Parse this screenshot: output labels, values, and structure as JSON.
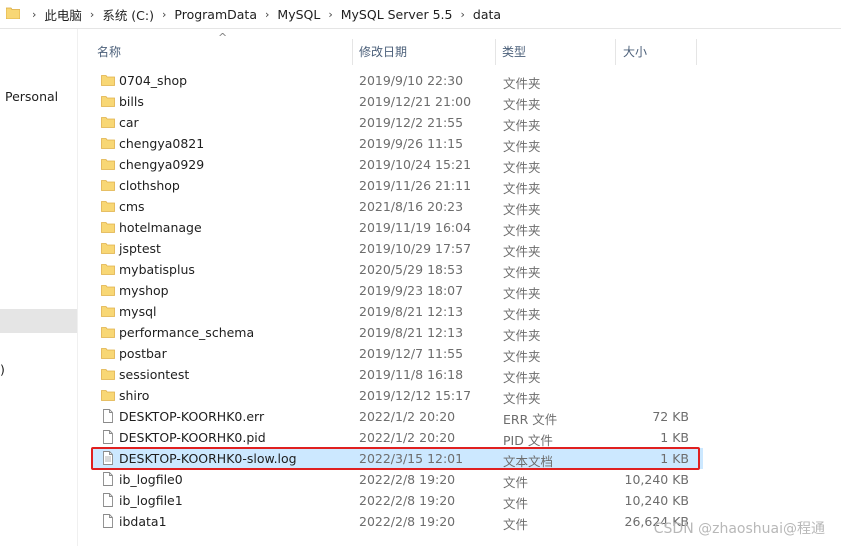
{
  "breadcrumb": [
    "此电脑",
    "系统 (C:)",
    "ProgramData",
    "MySQL",
    "MySQL Server 5.5",
    "data"
  ],
  "nav": {
    "personal": "Personal",
    "partial": ")"
  },
  "columns": {
    "name": "名称",
    "modified": "修改日期",
    "type": "类型",
    "size": "大小"
  },
  "sort_indicator": "^",
  "files": [
    {
      "name": "0704_shop",
      "modified": "2019/9/10 22:30",
      "type": "文件夹",
      "size": "",
      "kind": "folder"
    },
    {
      "name": "bills",
      "modified": "2019/12/21 21:00",
      "type": "文件夹",
      "size": "",
      "kind": "folder"
    },
    {
      "name": "car",
      "modified": "2019/12/2 21:55",
      "type": "文件夹",
      "size": "",
      "kind": "folder"
    },
    {
      "name": "chengya0821",
      "modified": "2019/9/26 11:15",
      "type": "文件夹",
      "size": "",
      "kind": "folder"
    },
    {
      "name": "chengya0929",
      "modified": "2019/10/24 15:21",
      "type": "文件夹",
      "size": "",
      "kind": "folder"
    },
    {
      "name": "clothshop",
      "modified": "2019/11/26 21:11",
      "type": "文件夹",
      "size": "",
      "kind": "folder"
    },
    {
      "name": "cms",
      "modified": "2021/8/16 20:23",
      "type": "文件夹",
      "size": "",
      "kind": "folder"
    },
    {
      "name": "hotelmanage",
      "modified": "2019/11/19 16:04",
      "type": "文件夹",
      "size": "",
      "kind": "folder"
    },
    {
      "name": "jsptest",
      "modified": "2019/10/29 17:57",
      "type": "文件夹",
      "size": "",
      "kind": "folder"
    },
    {
      "name": "mybatisplus",
      "modified": "2020/5/29 18:53",
      "type": "文件夹",
      "size": "",
      "kind": "folder"
    },
    {
      "name": "myshop",
      "modified": "2019/9/23 18:07",
      "type": "文件夹",
      "size": "",
      "kind": "folder"
    },
    {
      "name": "mysql",
      "modified": "2019/8/21 12:13",
      "type": "文件夹",
      "size": "",
      "kind": "folder"
    },
    {
      "name": "performance_schema",
      "modified": "2019/8/21 12:13",
      "type": "文件夹",
      "size": "",
      "kind": "folder"
    },
    {
      "name": "postbar",
      "modified": "2019/12/7 11:55",
      "type": "文件夹",
      "size": "",
      "kind": "folder"
    },
    {
      "name": "sessiontest",
      "modified": "2019/11/8 16:18",
      "type": "文件夹",
      "size": "",
      "kind": "folder"
    },
    {
      "name": "shiro",
      "modified": "2019/12/12 15:17",
      "type": "文件夹",
      "size": "",
      "kind": "folder"
    },
    {
      "name": "DESKTOP-KOORHK0.err",
      "modified": "2022/1/2 20:20",
      "type": "ERR 文件",
      "size": "72 KB",
      "kind": "file"
    },
    {
      "name": "DESKTOP-KOORHK0.pid",
      "modified": "2022/1/2 20:20",
      "type": "PID 文件",
      "size": "1 KB",
      "kind": "file"
    },
    {
      "name": "DESKTOP-KOORHK0-slow.log",
      "modified": "2022/3/15 12:01",
      "type": "文本文档",
      "size": "1 KB",
      "kind": "textfile",
      "selected": true
    },
    {
      "name": "ib_logfile0",
      "modified": "2022/2/8 19:20",
      "type": "文件",
      "size": "10,240 KB",
      "kind": "file"
    },
    {
      "name": "ib_logfile1",
      "modified": "2022/2/8 19:20",
      "type": "文件",
      "size": "10,240 KB",
      "kind": "file"
    },
    {
      "name": "ibdata1",
      "modified": "2022/2/8 19:20",
      "type": "文件",
      "size": "26,624 KB",
      "kind": "file"
    }
  ],
  "watermark": "CSDN @zhaoshuai@程通",
  "colors": {
    "folder": "#f8d775",
    "selection": "#cce8ff",
    "highlight_box": "#e02020",
    "header_text": "#4c607a"
  }
}
